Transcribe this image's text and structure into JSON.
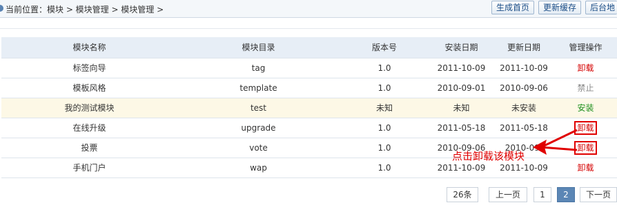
{
  "breadcrumb": "当前位置：模块 > 模块管理 > 模块管理 >",
  "toolbar": {
    "gen_home": "生成首页",
    "refresh_cache": "更新缓存",
    "backend_home": "后台地"
  },
  "table": {
    "headers": [
      "模块名称",
      "模块目录",
      "版本号",
      "安装日期",
      "更新日期",
      "管理操作"
    ],
    "rows": [
      {
        "name": "标签向导",
        "dir": "tag",
        "version": "1.0",
        "installed": "2011-10-09",
        "updated": "2011-10-09",
        "action": "卸载"
      },
      {
        "name": "模板风格",
        "dir": "template",
        "version": "1.0",
        "installed": "2010-09-01",
        "updated": "2010-09-06",
        "action": "禁止"
      },
      {
        "name": "我的测试模块",
        "dir": "test",
        "version": "未知",
        "installed": "未知",
        "updated": "未安装",
        "action": "安装"
      },
      {
        "name": "在线升级",
        "dir": "upgrade",
        "version": "1.0",
        "installed": "2011-05-18",
        "updated": "2011-05-18",
        "action": "卸载"
      },
      {
        "name": "投票",
        "dir": "vote",
        "version": "1.0",
        "installed": "2010-09-06",
        "updated": "2010-09-",
        "action": "卸载"
      },
      {
        "name": "手机门户",
        "dir": "wap",
        "version": "1.0",
        "installed": "2011-10-09",
        "updated": "2011-10-09",
        "action": "卸载"
      }
    ]
  },
  "annotation": "点击卸载该模块",
  "pager": {
    "total": "26条",
    "prev": "上一页",
    "page1": "1",
    "page2": "2",
    "next": "下一页"
  },
  "colors": {
    "uninstall": "#d40000",
    "disabled": "#888888",
    "install": "#1d8f1d",
    "highlight_row": "#fdf8e6",
    "header_bg": "#e7eef6",
    "active_page": "#5b86b5"
  }
}
